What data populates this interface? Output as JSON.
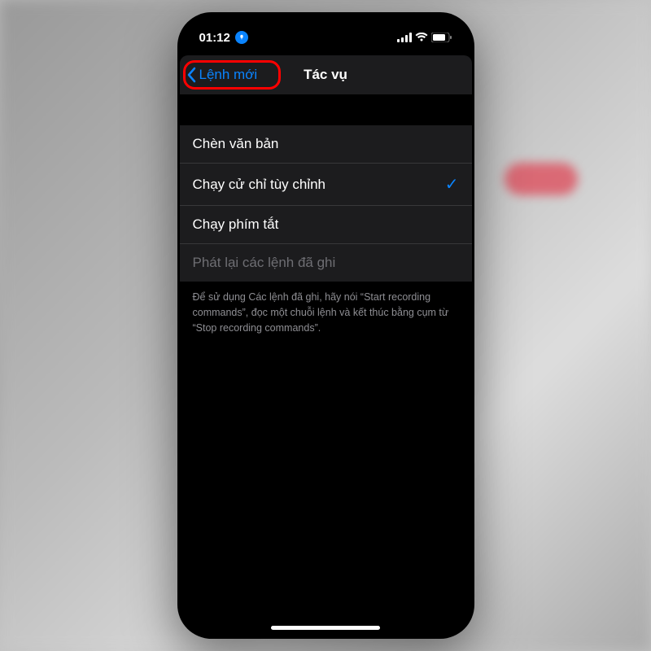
{
  "statusBar": {
    "time": "01:12"
  },
  "navBar": {
    "back": "Lệnh mới",
    "title": "Tác vụ"
  },
  "list": {
    "items": [
      {
        "label": "Chèn văn bản",
        "selected": false,
        "disabled": false
      },
      {
        "label": "Chạy cử chỉ tùy chỉnh",
        "selected": true,
        "disabled": false
      },
      {
        "label": "Chạy phím tắt",
        "selected": false,
        "disabled": false
      },
      {
        "label": "Phát lại các lệnh đã ghi",
        "selected": false,
        "disabled": true
      }
    ]
  },
  "footer": "Để sử dụng Các lệnh đã ghi, hãy nói “Start recording commands”, đọc một chuỗi lệnh và kết thúc bằng cụm từ “Stop recording commands”."
}
